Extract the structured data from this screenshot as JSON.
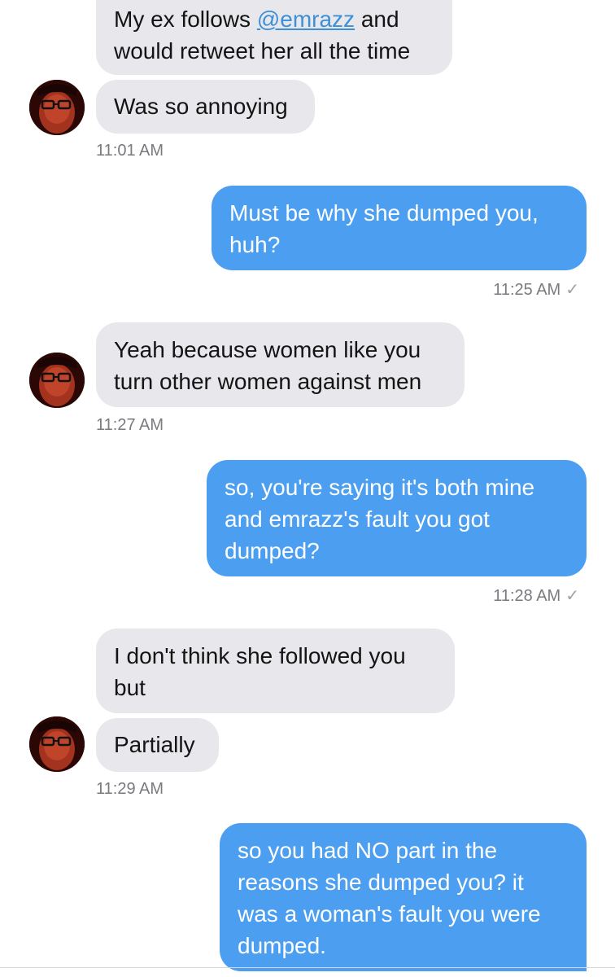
{
  "conversation": {
    "messages": [
      {
        "sender": "them",
        "lines": [
          "My ex follows",
          "would retweet her all the time"
        ],
        "mention": "@emrazz",
        "mention_suffix": " and"
      },
      {
        "sender": "them",
        "lines": [
          "Was so annoying"
        ],
        "timestamp": "11:01 AM"
      },
      {
        "sender": "me",
        "lines": [
          "Must be why she dumped you,",
          "huh?"
        ],
        "timestamp": "11:25 AM",
        "status": "✓"
      },
      {
        "sender": "them",
        "lines": [
          "Yeah because women like you",
          "turn other women against men"
        ],
        "timestamp": "11:27 AM"
      },
      {
        "sender": "me",
        "lines": [
          "so, you're saying it's both mine",
          "and emrazz's fault you got",
          "dumped?"
        ],
        "timestamp": "11:28 AM",
        "status": "✓"
      },
      {
        "sender": "them",
        "lines": [
          "I don't think she followed you",
          "but"
        ]
      },
      {
        "sender": "them",
        "lines": [
          "Partially"
        ],
        "timestamp": "11:29 AM"
      },
      {
        "sender": "me",
        "lines": [
          "so you had NO part in the",
          "reasons she dumped you? it",
          "was a woman's fault you were",
          "dumped."
        ]
      }
    ]
  },
  "colors": {
    "incoming_bubble": "#e8e8ec",
    "outgoing_bubble": "#4c9ff0",
    "mention_link": "#3d8fd6",
    "timestamp": "#7a7a7f"
  },
  "icons": {
    "avatar": "profile-photo",
    "status": "checkmark"
  }
}
